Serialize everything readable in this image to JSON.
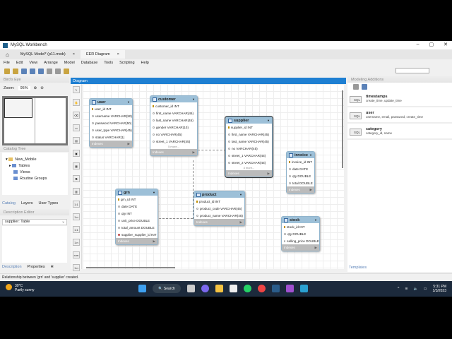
{
  "window": {
    "title": "MySQL Workbench",
    "controls": [
      "–",
      "▢",
      "✕"
    ]
  },
  "tabs": [
    {
      "label": "MySQL Model* (p11.mwb)",
      "close": "×"
    },
    {
      "label": "EER Diagram",
      "close": "×"
    }
  ],
  "menu": [
    "File",
    "Edit",
    "View",
    "Arrange",
    "Model",
    "Database",
    "Tools",
    "Scripting",
    "Help"
  ],
  "left": {
    "birds_eye": "Bird's Eye",
    "zoom_label": "Zoom:",
    "zoom_value": "95%",
    "catalog_tree": "Catalog Tree",
    "tree": {
      "root": "New_Mobile",
      "children": [
        "Tables",
        "Views",
        "Routine Groups"
      ]
    },
    "tabs": [
      "Catalog",
      "Layers",
      "User Types"
    ],
    "description_editor": "Description Editor",
    "selected_object": "supplier: Table",
    "bottom_tabs": [
      "Description",
      "Properties",
      "H"
    ]
  },
  "diagram": {
    "title": "Diagram",
    "indexes_label": "Indexes",
    "tables": [
      {
        "id": "user",
        "name": "user",
        "cols": [
          [
            "pk",
            "user_id INT"
          ],
          [
            "n",
            "username VARCHAR(50)"
          ],
          [
            "n",
            "password VARCHAR(50)"
          ],
          [
            "n",
            "user_type VARCHAR(45)"
          ],
          [
            "n",
            "status VARCHAR(1)"
          ]
        ]
      },
      {
        "id": "customer",
        "name": "customer",
        "cols": [
          [
            "pk",
            "customer_id INT"
          ],
          [
            "n",
            "first_name VARCHAR(45)"
          ],
          [
            "n",
            "last_name VARCHAR(45)"
          ],
          [
            "n",
            "gender VARCHAR(10)"
          ],
          [
            "n",
            "no VARCHAR(45)"
          ],
          [
            "n",
            "street_1 VARCHAR(45)"
          ]
        ],
        "more": "5 more..."
      },
      {
        "id": "supplier",
        "name": "supplier",
        "cols": [
          [
            "pk",
            "supplier_id INT"
          ],
          [
            "n",
            "first_name VARCHAR(45)"
          ],
          [
            "n",
            "last_name VARCHAR(45)"
          ],
          [
            "n",
            "no VARCHAR(45)"
          ],
          [
            "n",
            "street_1 VARCHAR(45)"
          ],
          [
            "n",
            "street_2 VARCHAR(45)"
          ]
        ],
        "more": "4 more..."
      },
      {
        "id": "invoice",
        "name": "invoice",
        "cols": [
          [
            "pk",
            "invoice_id INT"
          ],
          [
            "n",
            "date DATE"
          ],
          [
            "n",
            "qty DOUBLE"
          ],
          [
            "n",
            "total DOUBLE"
          ]
        ]
      },
      {
        "id": "grn",
        "name": "grn",
        "cols": [
          [
            "pk",
            "grn_id INT"
          ],
          [
            "n",
            "date DATE"
          ],
          [
            "n",
            "qty INT"
          ],
          [
            "n",
            "unit_price DOUBLE"
          ],
          [
            "n",
            "total_amount DOUBLE"
          ],
          [
            "fk",
            "supplier_supplier_id INT"
          ]
        ]
      },
      {
        "id": "product",
        "name": "product",
        "cols": [
          [
            "pk",
            "product_id INT"
          ],
          [
            "n",
            "product_code VARCHAR(45)"
          ],
          [
            "n",
            "product_name VARCHAR(45)"
          ]
        ]
      },
      {
        "id": "stock",
        "name": "stock",
        "cols": [
          [
            "pk",
            "stock_id INT"
          ],
          [
            "n",
            "qty DOUBLE"
          ],
          [
            "n",
            "selling_price DOUBLE"
          ]
        ]
      }
    ]
  },
  "right": {
    "title": "Modeling Additions",
    "items": [
      {
        "name": "timestamps",
        "fields": "create_time, update_time"
      },
      {
        "name": "user",
        "fields": "username, email, password, create_time"
      },
      {
        "name": "category",
        "fields": "category_id, name"
      }
    ],
    "templates_tab": "Templates",
    "sql_badge": "SQL"
  },
  "status": "Relationship between 'grn' and 'supplier' created.",
  "taskbar": {
    "temp": "30°C",
    "weather": "Partly sunny",
    "search": "Search",
    "time": "5:31 PM",
    "date": "1/3/2023"
  }
}
